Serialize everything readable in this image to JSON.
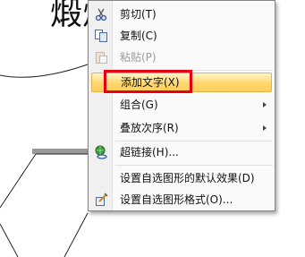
{
  "background": {
    "text": "煅烧"
  },
  "menu": {
    "items": [
      {
        "label": "剪切(T)",
        "icon": "scissors-icon",
        "enabled": true
      },
      {
        "label": "复制(C)",
        "icon": "copy-icon",
        "enabled": true
      },
      {
        "label": "粘贴(P)",
        "icon": "paste-icon",
        "enabled": false
      },
      {
        "label": "添加文字(X)",
        "enabled": true,
        "highlighted": true
      },
      {
        "label": "组合(G)",
        "enabled": true,
        "submenu": true
      },
      {
        "label": "叠放次序(R)",
        "enabled": true,
        "submenu": true
      },
      {
        "label": "超链接(H)...",
        "icon": "hyperlink-globe-icon",
        "enabled": true
      },
      {
        "label": "设置自选图形的默认效果(D)",
        "enabled": true
      },
      {
        "label": "设置自选图形格式(O)...",
        "icon": "format-shape-icon",
        "enabled": true
      }
    ]
  },
  "colors": {
    "highlight": "#ffd66e",
    "annotation_box": "#e60012"
  }
}
